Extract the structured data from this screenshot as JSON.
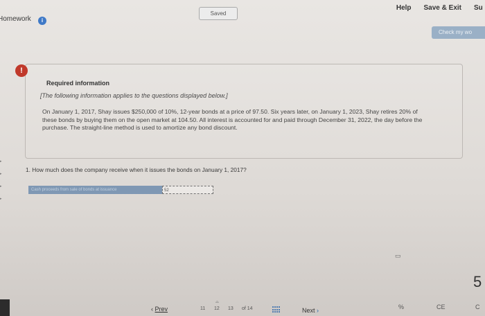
{
  "header": {
    "saved": "Saved",
    "help": "Help",
    "save_exit": "Save & Exit",
    "submit_partial": "Su",
    "homework": "Homework",
    "info_symbol": "i",
    "check_work": "Check my wo"
  },
  "card": {
    "alert_symbol": "!",
    "title": "Required information",
    "note": "[The following information applies to the questions displayed below.]",
    "scenario": "On January 1, 2017, Shay issues $250,000 of 10%, 12-year bonds at a price of 97.50. Six years later, on January 1, 2023, Shay retires 20% of these bonds by buying them on the open market at 104.50. All interest is accounted for and paid through December 31, 2022, the day before the purchase. The straight-line method is used to amortize any bond discount."
  },
  "question": {
    "text": "1. How much does the company receive when it issues the bonds on January 1, 2017?",
    "answer_label": "Cash proceeds from sale of bonds at issuance",
    "answer_value": "52"
  },
  "calculator": {
    "display_digit": "5",
    "percent_key": "%",
    "ce_key": "CE",
    "c_key": "C"
  },
  "nav": {
    "prev": "Prev",
    "prev_chevron": "‹",
    "page_11": "11",
    "page_12": "12",
    "page_13": "13",
    "of_total": "of 14",
    "next": "Next",
    "next_chevron": "›"
  }
}
